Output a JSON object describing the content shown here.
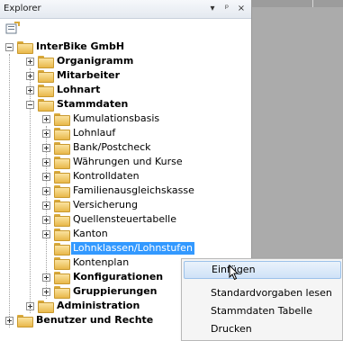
{
  "panel": {
    "title": "Explorer",
    "buttons": {
      "dropdown": "▾",
      "pin": "ᵖ",
      "close": "×"
    }
  },
  "tree": {
    "root": "InterBike GmbH",
    "items": [
      {
        "label": "InterBike GmbH",
        "bold": true,
        "expanded": true
      },
      {
        "label": "Organigramm",
        "bold": true,
        "expanded": false
      },
      {
        "label": "Mitarbeiter",
        "bold": true,
        "expanded": false
      },
      {
        "label": "Lohnart",
        "bold": true,
        "expanded": false
      },
      {
        "label": "Stammdaten",
        "bold": true,
        "expanded": true
      },
      {
        "label": "Kumulationsbasis",
        "bold": false,
        "expanded": false
      },
      {
        "label": "Lohnlauf",
        "bold": false,
        "expanded": false
      },
      {
        "label": "Bank/Postcheck",
        "bold": false,
        "expanded": false
      },
      {
        "label": "Währungen und Kurse",
        "bold": false,
        "expanded": false
      },
      {
        "label": "Kontrolldaten",
        "bold": false,
        "expanded": false
      },
      {
        "label": "Familienausgleichskasse",
        "bold": false,
        "expanded": false
      },
      {
        "label": "Versicherung",
        "bold": false,
        "expanded": false
      },
      {
        "label": "Quellensteuertabelle",
        "bold": false,
        "expanded": false
      },
      {
        "label": "Kanton",
        "bold": false,
        "expanded": false
      },
      {
        "label": "Lohnklassen/Lohnstufen",
        "bold": false,
        "selected": true
      },
      {
        "label": "Kontenplan",
        "bold": false
      },
      {
        "label": "Konfigurationen",
        "bold": true,
        "expanded": false
      },
      {
        "label": "Gruppierungen",
        "bold": true,
        "expanded": false
      },
      {
        "label": "Administration",
        "bold": true,
        "expanded": false
      },
      {
        "label": "Benutzer und Rechte",
        "bold": true,
        "expanded": false
      }
    ]
  },
  "context_menu": {
    "items": [
      {
        "label": "Einfügen",
        "hover": true
      },
      {
        "label": "Standardvorgaben lesen"
      },
      {
        "label": "Stammdaten Tabelle"
      },
      {
        "label": "Drucken"
      }
    ]
  },
  "colors": {
    "selection": "#3399ff",
    "menu_hover": "#cfe2f7",
    "workspace": "#ababab"
  }
}
